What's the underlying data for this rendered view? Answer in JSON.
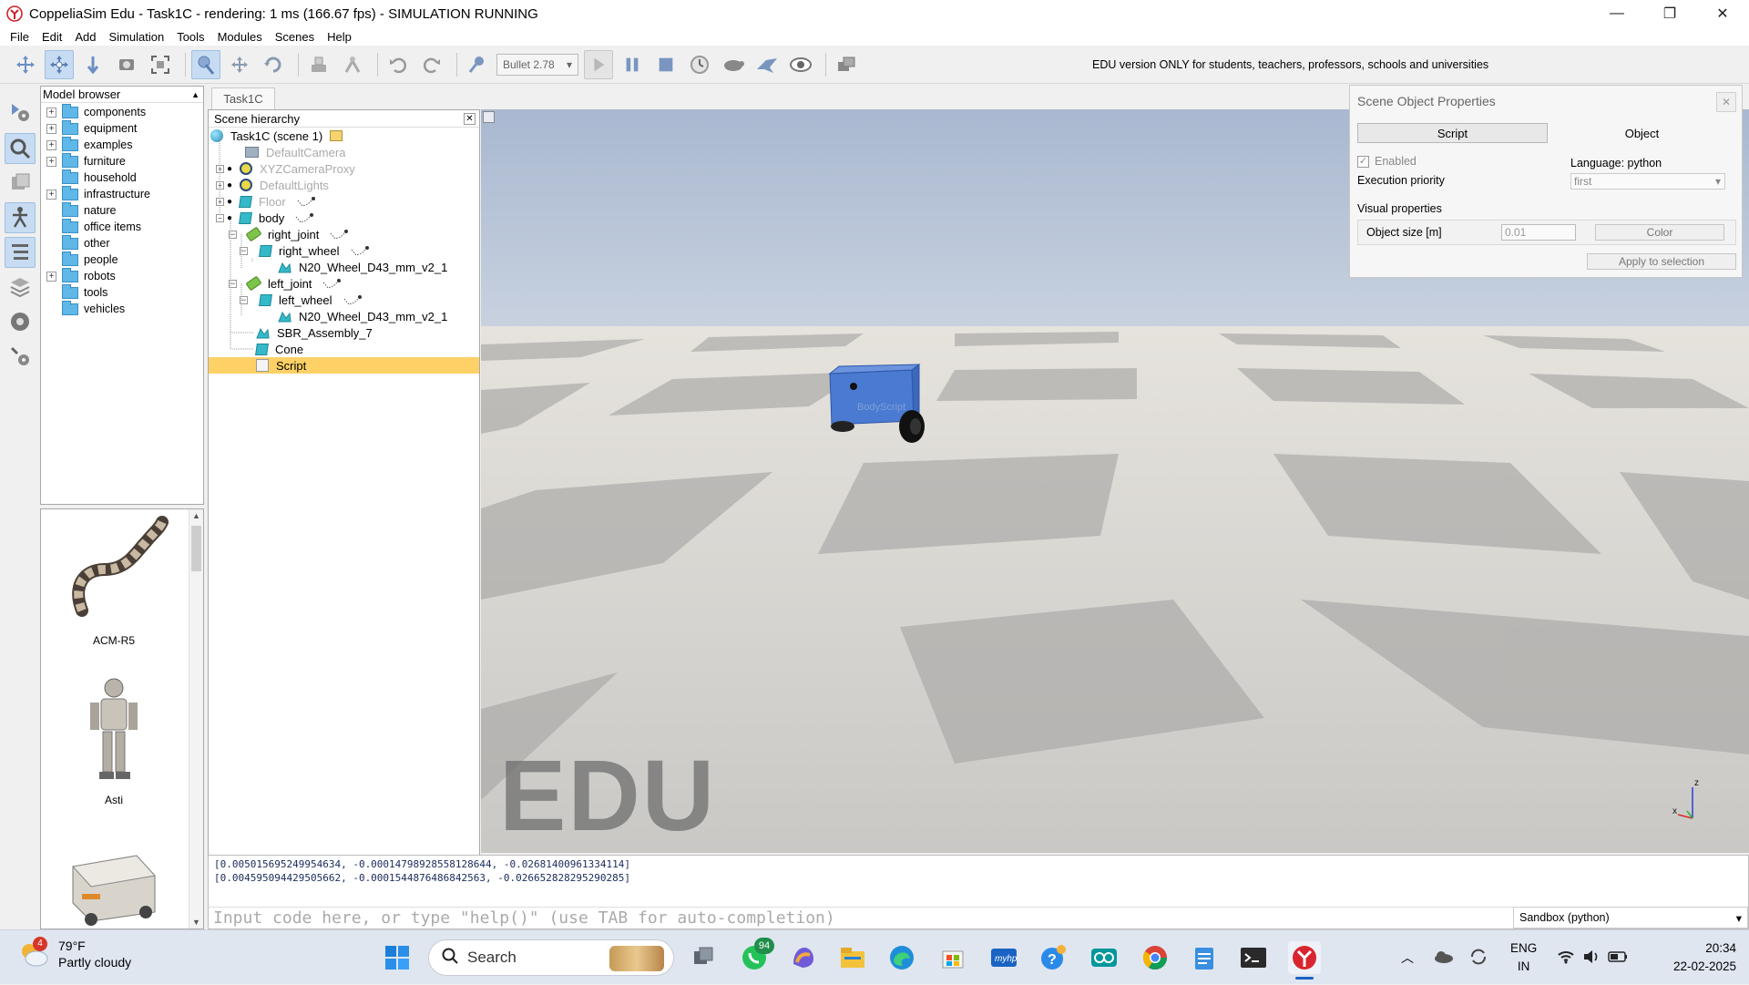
{
  "window": {
    "title": "CoppeliaSim Edu - Task1C - rendering: 1 ms (166.67 fps) - SIMULATION RUNNING",
    "minimize": "—",
    "maximize": "❐",
    "close": "✕"
  },
  "menu": [
    "File",
    "Edit",
    "Add",
    "Simulation",
    "Tools",
    "Modules",
    "Scenes",
    "Help"
  ],
  "toolbar": {
    "physics_engine": "Bullet 2.78",
    "edu_notice": "EDU version ONLY for students, teachers, professors, schools and universities"
  },
  "model_browser": {
    "title": "Model browser",
    "folders": [
      {
        "label": "components",
        "expandable": true
      },
      {
        "label": "equipment",
        "expandable": true
      },
      {
        "label": "examples",
        "expandable": true
      },
      {
        "label": "furniture",
        "expandable": true
      },
      {
        "label": "household",
        "expandable": false
      },
      {
        "label": "infrastructure",
        "expandable": true
      },
      {
        "label": "nature",
        "expandable": false
      },
      {
        "label": "office items",
        "expandable": false
      },
      {
        "label": "other",
        "expandable": false
      },
      {
        "label": "people",
        "expandable": false
      },
      {
        "label": "robots",
        "expandable": true
      },
      {
        "label": "tools",
        "expandable": false
      },
      {
        "label": "vehicles",
        "expandable": false
      }
    ],
    "thumbnails": [
      "ACM-R5",
      "Asti"
    ]
  },
  "scene_tab": "Task1C",
  "hierarchy": {
    "title": "Scene hierarchy",
    "rows": [
      {
        "label": "Task1C (scene 1)",
        "icon": "scene-icon",
        "depth": 0,
        "dim": false
      },
      {
        "label": "DefaultCamera",
        "icon": "camera-icon",
        "depth": 1,
        "dim": true
      },
      {
        "label": "XYZCameraProxy",
        "icon": "light-icon",
        "depth": 1,
        "dim": true
      },
      {
        "label": "DefaultLights",
        "icon": "light-icon",
        "depth": 1,
        "dim": true
      },
      {
        "label": "Floor",
        "icon": "shape-icon",
        "depth": 1,
        "dim": true
      },
      {
        "label": "body",
        "icon": "shape-icon",
        "depth": 1,
        "dim": false
      },
      {
        "label": "right_joint",
        "icon": "joint-icon",
        "depth": 2,
        "dim": false
      },
      {
        "label": "right_wheel",
        "icon": "shape-icon",
        "depth": 3,
        "dim": false
      },
      {
        "label": "N20_Wheel_D43_mm_v2_1",
        "icon": "mesh-icon",
        "depth": 4,
        "dim": false
      },
      {
        "label": "left_joint",
        "icon": "joint-icon",
        "depth": 2,
        "dim": false
      },
      {
        "label": "left_wheel",
        "icon": "shape-icon",
        "depth": 3,
        "dim": false
      },
      {
        "label": "N20_Wheel_D43_mm_v2_1",
        "icon": "mesh-icon",
        "depth": 4,
        "dim": false
      },
      {
        "label": "SBR_Assembly_7",
        "icon": "mesh-icon",
        "depth": 2,
        "dim": false
      },
      {
        "label": "Cone",
        "icon": "shape-icon",
        "depth": 2,
        "dim": false
      },
      {
        "label": "Script",
        "icon": "script-icon",
        "depth": 2,
        "dim": false,
        "selected": true
      }
    ]
  },
  "viewport": {
    "watermark": "EDU",
    "axis_z": "z",
    "axis_x": "x",
    "robot_label": "BodyScript"
  },
  "properties": {
    "title": "Scene Object Properties",
    "tab_script": "Script",
    "tab_object": "Object",
    "enabled_label": "Enabled",
    "language_label": "Language: python",
    "priority_label": "Execution priority",
    "priority_value": "first",
    "visual_label": "Visual properties",
    "object_size_label": "Object size [m]",
    "object_size_value": "0.01",
    "color_button": "Color",
    "apply_button": "Apply to selection"
  },
  "console": {
    "lines": [
      "[0.005015695249954634, -0.00014798928558128644, -0.02681400961334114]",
      "[0.004595094429505662, -0.0001544876486842563, -0.026652828295290285]"
    ],
    "input_placeholder": "Input code here, or type \"help()\" (use TAB for auto-completion)",
    "sandbox": "Sandbox (python)"
  },
  "taskbar": {
    "weather_temp": "79°F",
    "weather_desc": "Partly cloudy",
    "weather_badge": "4",
    "search_label": "Search",
    "whatsapp_badge": "94",
    "lang_top": "ENG",
    "lang_bottom": "IN",
    "time": "20:34",
    "date": "22-02-2025"
  }
}
